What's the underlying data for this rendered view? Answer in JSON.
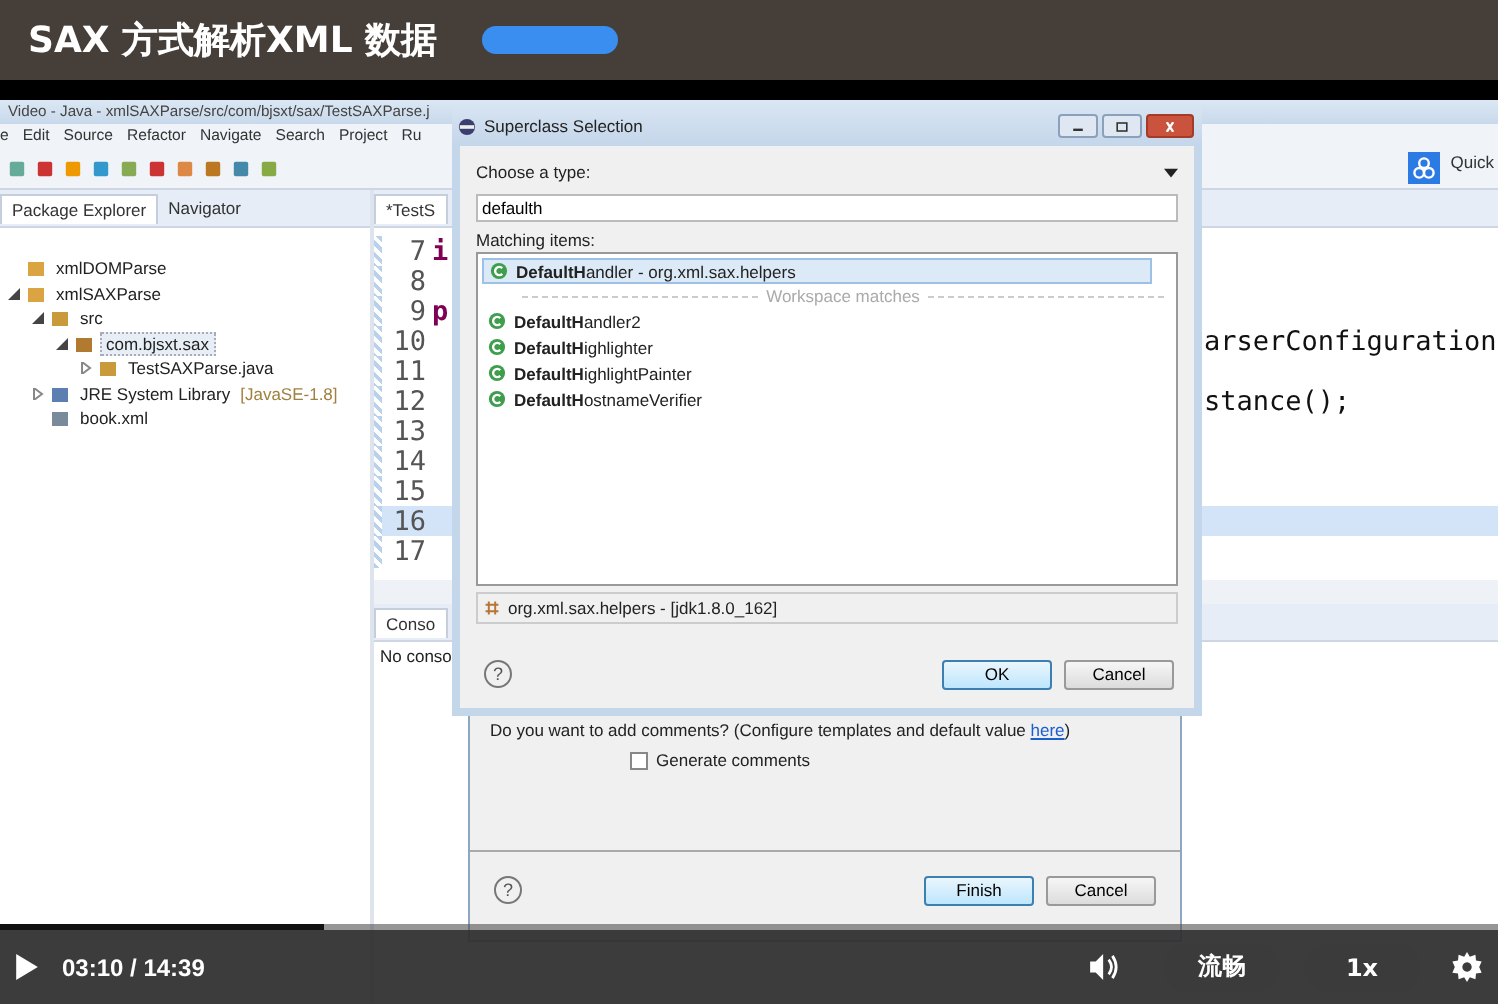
{
  "header": {
    "title": "SAX 方式解析XML 数据"
  },
  "eclipse": {
    "title": "Video - Java - xmlSAXParse/src/com/bjsxt/sax/TestSAXParse.j",
    "menu": [
      "e",
      "Edit",
      "Source",
      "Refactor",
      "Navigate",
      "Search",
      "Project",
      "Ru"
    ],
    "quick_access": "Quick",
    "explorer": {
      "tabs": [
        {
          "label": "Package Explorer",
          "selected": true
        },
        {
          "label": "Navigator",
          "selected": false
        }
      ],
      "tree": [
        {
          "label": "xmlDOMParse",
          "kind": "project",
          "selected": false
        },
        {
          "label": "xmlSAXParse",
          "kind": "project",
          "selected": false,
          "expanded": true,
          "children": [
            {
              "label": "src",
              "kind": "folder",
              "selected": false,
              "expanded": true,
              "children": [
                {
                  "label": "com.bjsxt.sax",
                  "kind": "package",
                  "selected": true,
                  "expanded": true,
                  "children": [
                    {
                      "label": "TestSAXParse.java",
                      "kind": "java",
                      "selected": false,
                      "expanded": false
                    }
                  ]
                }
              ]
            },
            {
              "label": "JRE System Library",
              "suffix": "[JavaSE-1.8]",
              "kind": "library",
              "selected": false,
              "expanded": false
            },
            {
              "label": "book.xml",
              "kind": "xml",
              "selected": false
            }
          ]
        }
      ]
    },
    "editor": {
      "tab": "*TestS",
      "lines": [
        {
          "number": "7",
          "code_left": "i",
          "current": false
        },
        {
          "number": "8",
          "current": false
        },
        {
          "number": "9",
          "code_left": "p",
          "current": false
        },
        {
          "number": "10",
          "code_right": "arserConfiguration",
          "current": false
        },
        {
          "number": "11",
          "current": false
        },
        {
          "number": "12",
          "code_right": "stance();",
          "current": false
        },
        {
          "number": "13",
          "current": false
        },
        {
          "number": "14",
          "current": false
        },
        {
          "number": "15",
          "current": false
        },
        {
          "number": "16",
          "current": true
        },
        {
          "number": "17",
          "current": false
        }
      ]
    },
    "console": {
      "tab": "Conso",
      "text": "No conso"
    }
  },
  "wizard": {
    "comment_text": "Do you want to add comments? (Configure templates and default value",
    "comment_link": "here",
    "comment_end": ")",
    "checkbox": {
      "label": "Generate comments",
      "checked": false
    },
    "help": "?",
    "buttons": [
      "Finish",
      "Cancel"
    ]
  },
  "superclass_dialog": {
    "title": "Superclass Selection",
    "choose_label": "Choose a type:",
    "search_value": "defaulth",
    "matching_label": "Matching items:",
    "items": [
      {
        "kind": "type",
        "text": "**DefaultH**andler - org.xml.sax.helpers",
        "selected": true
      },
      {
        "kind": "separator",
        "text": "Workspace matches"
      },
      {
        "kind": "type",
        "text": "**DefaultH**andler2",
        "selected": false
      },
      {
        "kind": "type",
        "text": "**DefaultH**ighlighter",
        "selected": false
      },
      {
        "kind": "type",
        "text": "**DefaultH**ighlightPainter",
        "selected": false
      },
      {
        "kind": "type",
        "text": "**DefaultH**ostnameVerifier",
        "selected": false
      }
    ],
    "status": "org.xml.sax.helpers - [jdk1.8.0_162]",
    "help": "?",
    "buttons": [
      "OK",
      "Cancel"
    ]
  },
  "player": {
    "progress": {
      "level": 0.216
    },
    "time": "03:10 / 14:39",
    "quality": "流畅",
    "speed": "1x"
  }
}
